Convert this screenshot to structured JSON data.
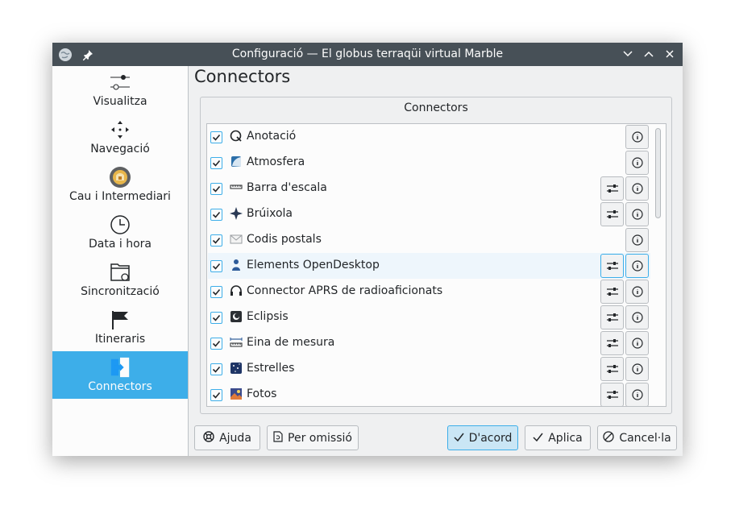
{
  "window": {
    "title": "Configuració — El globus terraqüi virtual Marble"
  },
  "sidebar": {
    "items": [
      {
        "label": "Visualitza",
        "icon": "view-sliders-icon"
      },
      {
        "label": "Navegació",
        "icon": "navigation-arrows-icon"
      },
      {
        "label": "Cau i Intermediari",
        "icon": "cache-proxy-icon"
      },
      {
        "label": "Data i hora",
        "icon": "clock-icon"
      },
      {
        "label": "Sincronització",
        "icon": "folder-sync-icon"
      },
      {
        "label": "Itineraris",
        "icon": "flag-icon"
      },
      {
        "label": "Connectors",
        "icon": "plugins-icon",
        "active": true
      }
    ]
  },
  "page": {
    "title": "Connectors"
  },
  "group": {
    "title": "Connectors"
  },
  "plugins": [
    {
      "name": "Anotació",
      "configurable": false
    },
    {
      "name": "Atmosfera",
      "configurable": false
    },
    {
      "name": "Barra d'escala",
      "configurable": true
    },
    {
      "name": "Brúixola",
      "configurable": true
    },
    {
      "name": "Codis postals",
      "configurable": false
    },
    {
      "name": "Elements OpenDesktop",
      "configurable": true
    },
    {
      "name": "Connector APRS de radioaficionats",
      "configurable": true
    },
    {
      "name": "Eclipsis",
      "configurable": true
    },
    {
      "name": "Eina de mesura",
      "configurable": true
    },
    {
      "name": "Estrelles",
      "configurable": true
    },
    {
      "name": "Fotos",
      "configurable": true
    }
  ],
  "buttons": {
    "help": "Ajuda",
    "defaults": "Per omissió",
    "ok": "D'acord",
    "apply": "Aplica",
    "cancel": "Cancel·la"
  },
  "colors": {
    "accent": "#3daee9",
    "titlebar": "#475057",
    "window": "#eff0f1"
  }
}
